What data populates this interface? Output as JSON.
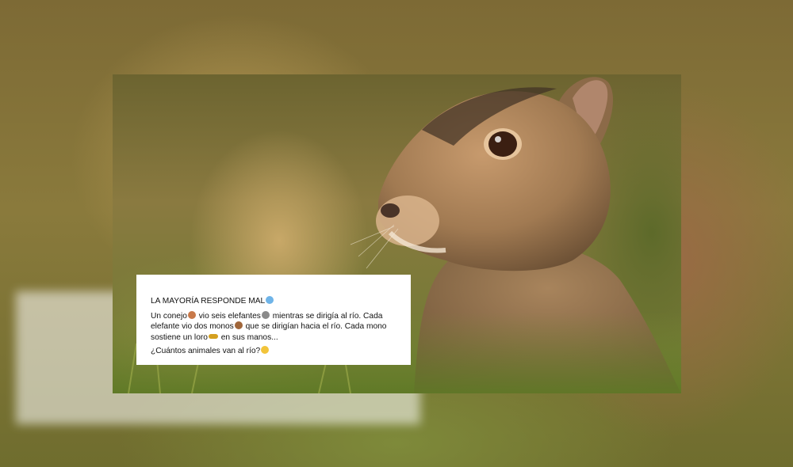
{
  "post": {
    "title": "LA MAYORÍA RESPONDE MAL",
    "title_emoji": "anxious-face-emoji",
    "body_parts": [
      "Un conejo",
      " vio seis elefantes",
      " mientras se dirigía al río. Cada elefante vio dos monos",
      " que se dirigían hacia el río. Cada mono sostiene un loro",
      "  en sus manos..."
    ],
    "body_emojis": [
      "rabbit-emoji",
      "elephant-emoji",
      "monkey-emoji",
      "parrot-emoji"
    ],
    "question": "¿Cuántos animales van al río?",
    "question_emoji": "flushed-face-emoji"
  },
  "colors": {
    "card_bg": "#ffffff",
    "text": "#111111",
    "rabbit_fur": "#a9825a"
  }
}
